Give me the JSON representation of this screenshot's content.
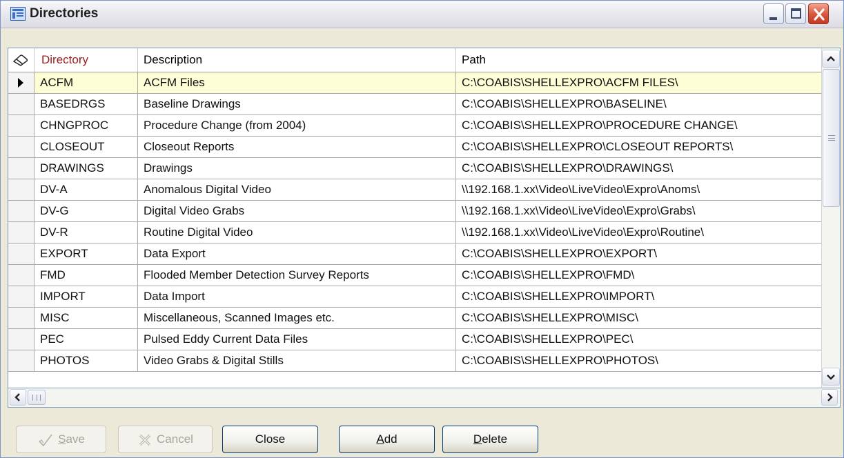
{
  "window": {
    "title": "Directories"
  },
  "grid": {
    "columns": [
      "Directory",
      "Description",
      "Path"
    ],
    "rows": [
      {
        "directory": "ACFM",
        "description": "ACFM Files",
        "path": "C:\\COABIS\\SHELLEXPRO\\ACFM FILES\\"
      },
      {
        "directory": "BASEDRGS",
        "description": "Baseline Drawings",
        "path": "C:\\COABIS\\SHELLEXPRO\\BASELINE\\"
      },
      {
        "directory": "CHNGPROC",
        "description": "Procedure Change (from 2004)",
        "path": "C:\\COABIS\\SHELLEXPRO\\PROCEDURE CHANGE\\"
      },
      {
        "directory": "CLOSEOUT",
        "description": "Closeout Reports",
        "path": "C:\\COABIS\\SHELLEXPRO\\CLOSEOUT REPORTS\\"
      },
      {
        "directory": "DRAWINGS",
        "description": "Drawings",
        "path": "C:\\COABIS\\SHELLEXPRO\\DRAWINGS\\"
      },
      {
        "directory": "DV-A",
        "description": "Anomalous Digital Video",
        "path": "\\\\192.168.1.xx\\Video\\LiveVideo\\Expro\\Anoms\\"
      },
      {
        "directory": "DV-G",
        "description": "Digital Video Grabs",
        "path": "\\\\192.168.1.xx\\Video\\LiveVideo\\Expro\\Grabs\\"
      },
      {
        "directory": "DV-R",
        "description": "Routine Digital Video",
        "path": "\\\\192.168.1.xx\\Video\\LiveVideo\\Expro\\Routine\\"
      },
      {
        "directory": "EXPORT",
        "description": "Data Export",
        "path": "C:\\COABIS\\SHELLEXPRO\\EXPORT\\"
      },
      {
        "directory": "FMD",
        "description": "Flooded Member Detection Survey Reports",
        "path": "C:\\COABIS\\SHELLEXPRO\\FMD\\"
      },
      {
        "directory": "IMPORT",
        "description": "Data Import",
        "path": "C:\\COABIS\\SHELLEXPRO\\IMPORT\\"
      },
      {
        "directory": "MISC",
        "description": "Miscellaneous, Scanned Images etc.",
        "path": "C:\\COABIS\\SHELLEXPRO\\MISC\\"
      },
      {
        "directory": "PEC",
        "description": "Pulsed Eddy Current Data Files",
        "path": "C:\\COABIS\\SHELLEXPRO\\PEC\\"
      },
      {
        "directory": "PHOTOS",
        "description": "Video Grabs & Digital Stills",
        "path": "C:\\COABIS\\SHELLEXPRO\\PHOTOS\\"
      }
    ]
  },
  "buttons": {
    "save": {
      "label": "Save",
      "enabled": false
    },
    "cancel": {
      "label": "Cancel",
      "enabled": false
    },
    "close": {
      "label": "Close",
      "enabled": true
    },
    "add": {
      "label": "Add",
      "enabled": true
    },
    "delete": {
      "label": "Delete",
      "enabled": true
    }
  },
  "colors": {
    "selected_row": "#fefed6",
    "directory_header": "#9b1c1c",
    "border": "#7f9db9"
  },
  "icons": {
    "header": "eraser-icon",
    "save": "checkmark-icon",
    "cancel": "cross-icon"
  }
}
